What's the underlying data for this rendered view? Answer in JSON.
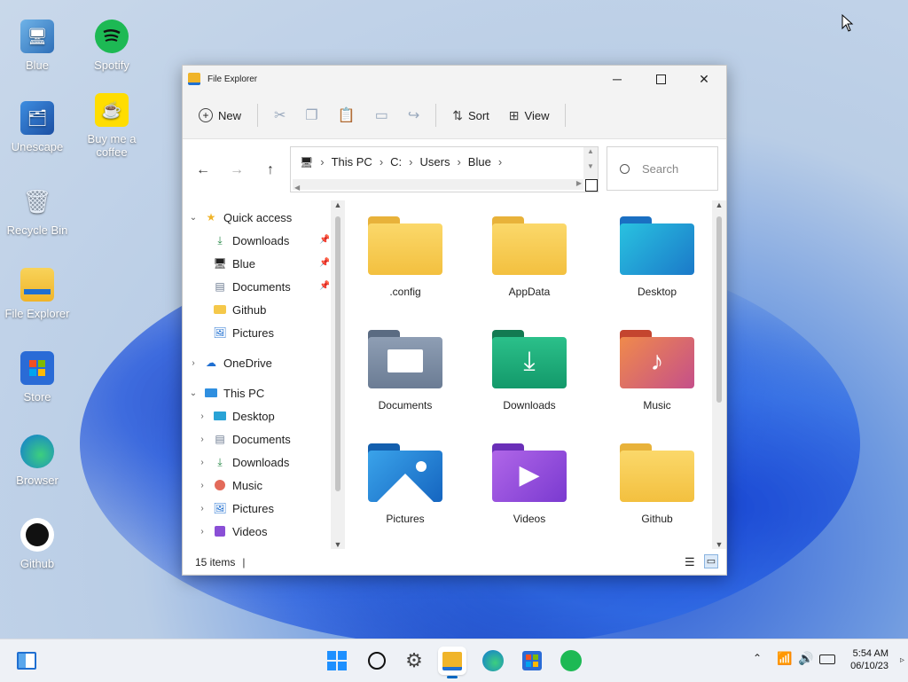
{
  "desktop": {
    "icons": [
      {
        "label": "Blue"
      },
      {
        "label": "Spotify"
      },
      {
        "label": "Unescape"
      },
      {
        "label": "Buy me a coffee"
      },
      {
        "label": "Recycle Bin"
      },
      {
        "label": "File Explorer"
      },
      {
        "label": "Store"
      },
      {
        "label": "Browser"
      },
      {
        "label": "Github"
      }
    ]
  },
  "window": {
    "title": "File Explorer",
    "toolbar": {
      "new_label": "New",
      "sort_label": "Sort",
      "view_label": "View"
    },
    "breadcrumb": [
      "This PC",
      "C:",
      "Users",
      "Blue"
    ],
    "search_placeholder": "Search",
    "nav": {
      "quick_access": "Quick access",
      "quick_items": [
        "Downloads",
        "Blue",
        "Documents",
        "Github",
        "Pictures"
      ],
      "onedrive": "OneDrive",
      "this_pc": "This PC",
      "pc_items": [
        "Desktop",
        "Documents",
        "Downloads",
        "Music",
        "Pictures",
        "Videos"
      ]
    },
    "folders": [
      ".config",
      "AppData",
      "Desktop",
      "Documents",
      "Downloads",
      "Music",
      "Pictures",
      "Videos",
      "Github"
    ],
    "status": {
      "count": "15 items"
    }
  },
  "taskbar": {
    "time": "5:54 AM",
    "date": "06/10/23"
  },
  "colors": {
    "folder_yellow": "#f7c948",
    "accent": "#0067c0"
  }
}
